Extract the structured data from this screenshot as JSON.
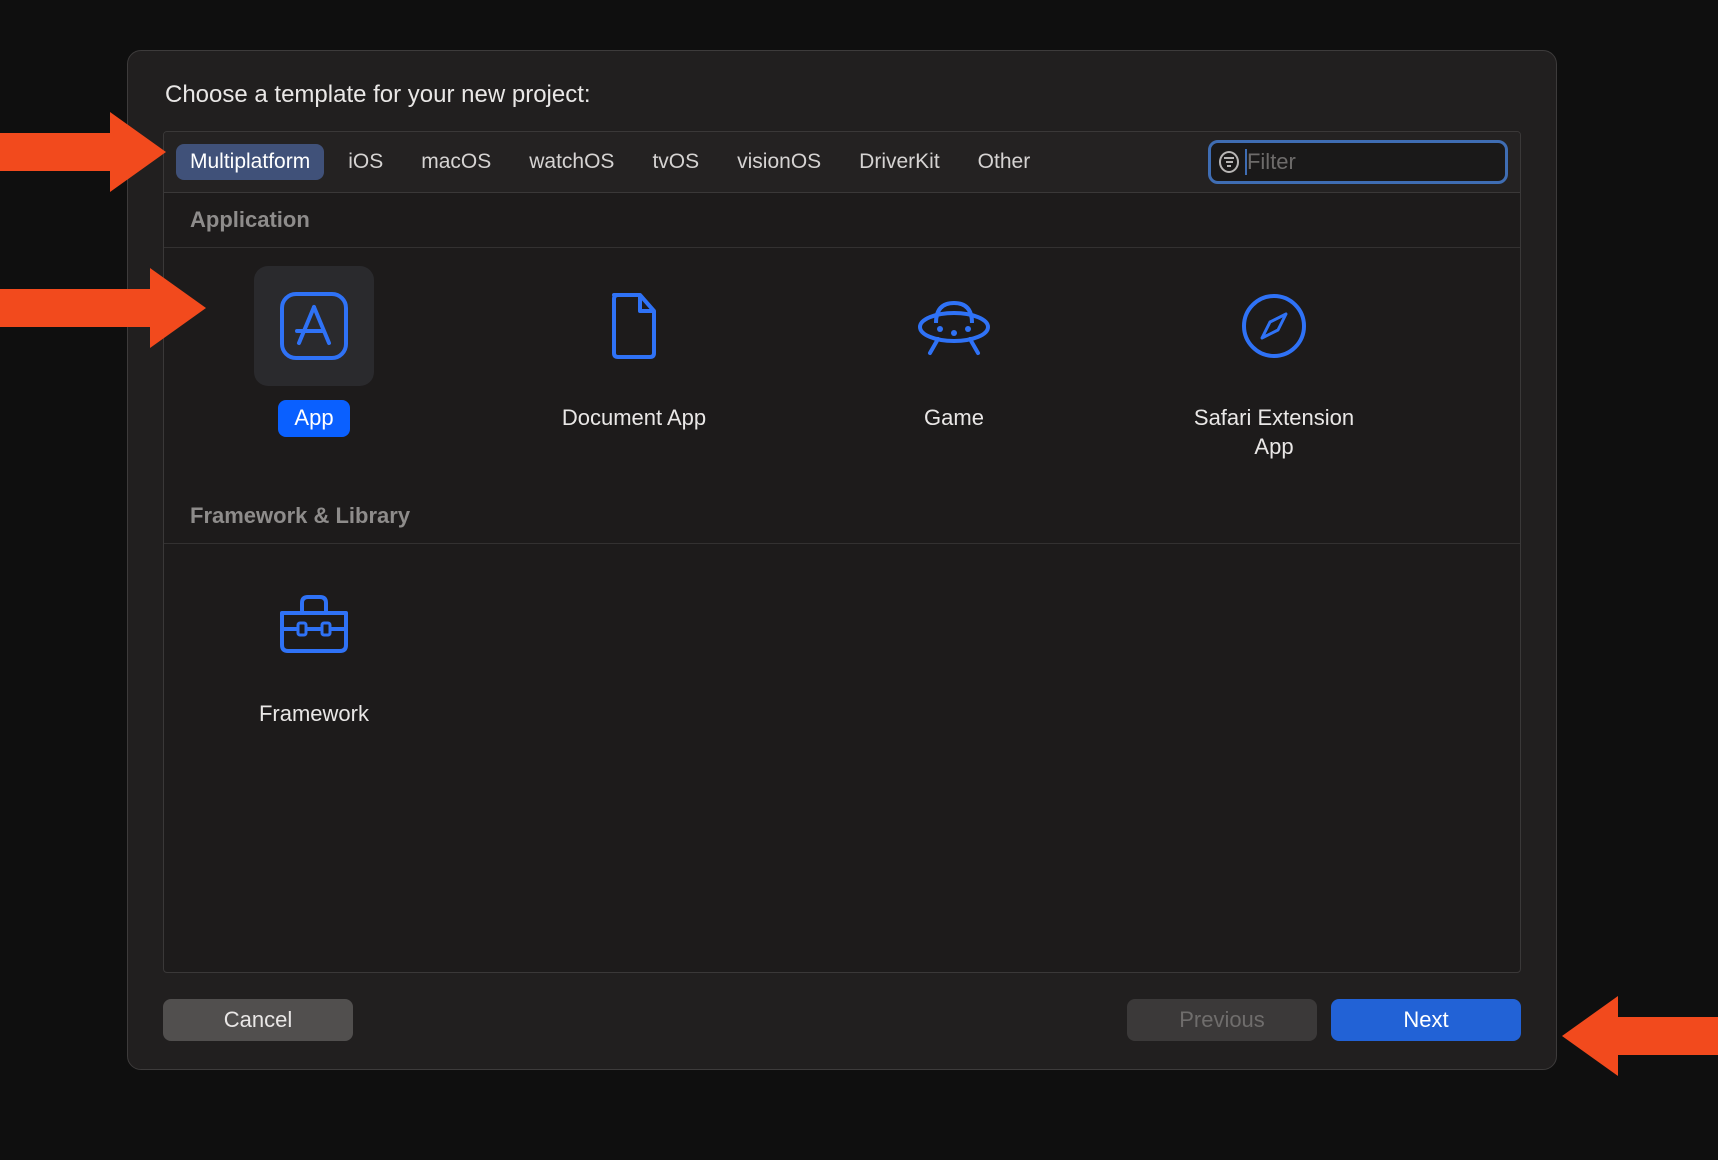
{
  "dialog": {
    "title": "Choose a template for your new project:"
  },
  "tabs": [
    {
      "label": "Multiplatform",
      "selected": true
    },
    {
      "label": "iOS",
      "selected": false
    },
    {
      "label": "macOS",
      "selected": false
    },
    {
      "label": "watchOS",
      "selected": false
    },
    {
      "label": "tvOS",
      "selected": false
    },
    {
      "label": "visionOS",
      "selected": false
    },
    {
      "label": "DriverKit",
      "selected": false
    },
    {
      "label": "Other",
      "selected": false
    }
  ],
  "filter": {
    "placeholder": "Filter",
    "value": ""
  },
  "sections": [
    {
      "title": "Application",
      "templates": [
        {
          "label": "App",
          "icon": "app",
          "selected": true
        },
        {
          "label": "Document App",
          "icon": "document",
          "selected": false
        },
        {
          "label": "Game",
          "icon": "game",
          "selected": false
        },
        {
          "label": "Safari Extension App",
          "icon": "compass",
          "selected": false
        }
      ]
    },
    {
      "title": "Framework & Library",
      "templates": [
        {
          "label": "Framework",
          "icon": "toolbox",
          "selected": false
        }
      ]
    }
  ],
  "footer": {
    "cancel": "Cancel",
    "previous": "Previous",
    "next": "Next"
  },
  "colors": {
    "accent_blue": "#2f72f6",
    "selection_blue": "#0a60ff",
    "tab_selected_bg": "#405179"
  }
}
